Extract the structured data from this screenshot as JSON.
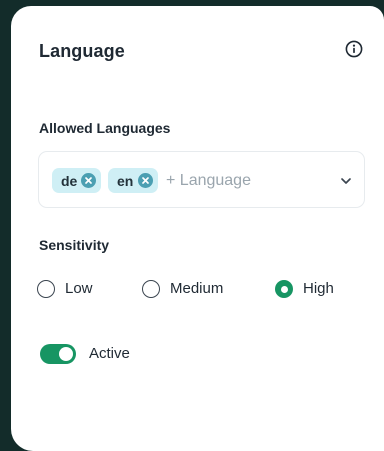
{
  "panel": {
    "title": "Language",
    "info_icon": "info-circle-icon"
  },
  "allowed_languages": {
    "label": "Allowed Languages",
    "chips": [
      {
        "label": "de",
        "remove_icon": "close-circle-icon"
      },
      {
        "label": "en",
        "remove_icon": "close-circle-icon"
      }
    ],
    "add_placeholder": "+ Language",
    "dropdown_icon": "chevron-down-icon"
  },
  "sensitivity": {
    "label": "Sensitivity",
    "options": [
      {
        "label": "Low",
        "selected": false
      },
      {
        "label": "Medium",
        "selected": false
      },
      {
        "label": "High",
        "selected": true
      }
    ]
  },
  "status_toggle": {
    "label": "Active",
    "on": true
  },
  "colors": {
    "background": "#132c2a",
    "card": "#ffffff",
    "accent_green": "#179563",
    "chip_background": "#cfeff5",
    "chip_remove": "#4b9fb2",
    "placeholder": "#9aa5ad"
  }
}
